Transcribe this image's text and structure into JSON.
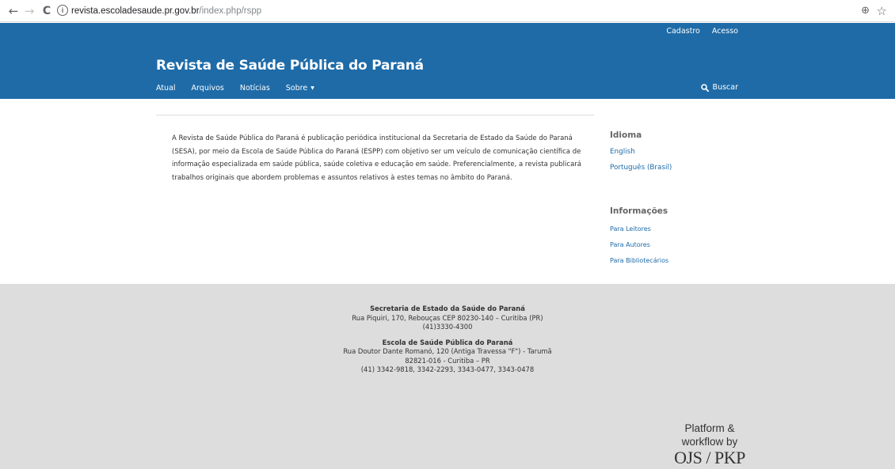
{
  "browser": {
    "back_icon": "←",
    "forward_icon": "→",
    "reload_icon": "C",
    "info_icon": "i",
    "url_host": "revista.escoladesaude.pr.gov.br",
    "url_path": "/index.php/rspp",
    "zoom_icon": "⊕",
    "star_icon": "☆"
  },
  "header": {
    "user_nav": [
      "Cadastro",
      "Acesso"
    ],
    "title": "Revista de Saúde Pública do Paraná",
    "nav": [
      "Atual",
      "Arquivos",
      "Notícias",
      "Sobre"
    ],
    "search_label": "Buscar",
    "color": "#1e6ba8"
  },
  "main": {
    "description": "A Revista de Saúde Pública do Paraná é publicação periódica institucional da Secretaria de Estado da Saúde do Paraná (SESA), por meio da Escola de Saúde Pública do Paraná (ESPP) com objetivo ser um veículo de comunicação científica de informação especializada em saúde pública, saúde coletiva e educação em saúde. Preferencialmente, a revista publicará trabalhos originais que abordem problemas e assuntos relativos à estes temas no âmbito do Paraná."
  },
  "sidebar": {
    "language_title": "Idioma",
    "languages": [
      "English",
      "Português (Brasil)"
    ],
    "info_title": "Informações",
    "info_links": [
      "Para Leitores",
      "Para Autores",
      "Para Bibliotecários"
    ]
  },
  "footer": {
    "org1_name": "Secretaria de Estado da Saúde do Paraná",
    "org1_address": "Rua Piquiri, 170, Rebouças CEP 80230-140 – Curitiba (PR)",
    "org1_phone": "(41)3330-4300",
    "org2_name": "Escola de Saúde Pública do Paraná",
    "org2_address1": "Rua Doutor Dante Romanó, 120 (Antiga Travessa \"F\") - Tarumã",
    "org2_address2": "82821-016 - Curitiba – PR",
    "org2_phone": "(41) 3342-9818, 3342-2293, 3343-0477, 3343-0478",
    "platform_line1": "Platform &",
    "platform_line2": "workflow by",
    "platform_logo": "OJS / PKP"
  }
}
